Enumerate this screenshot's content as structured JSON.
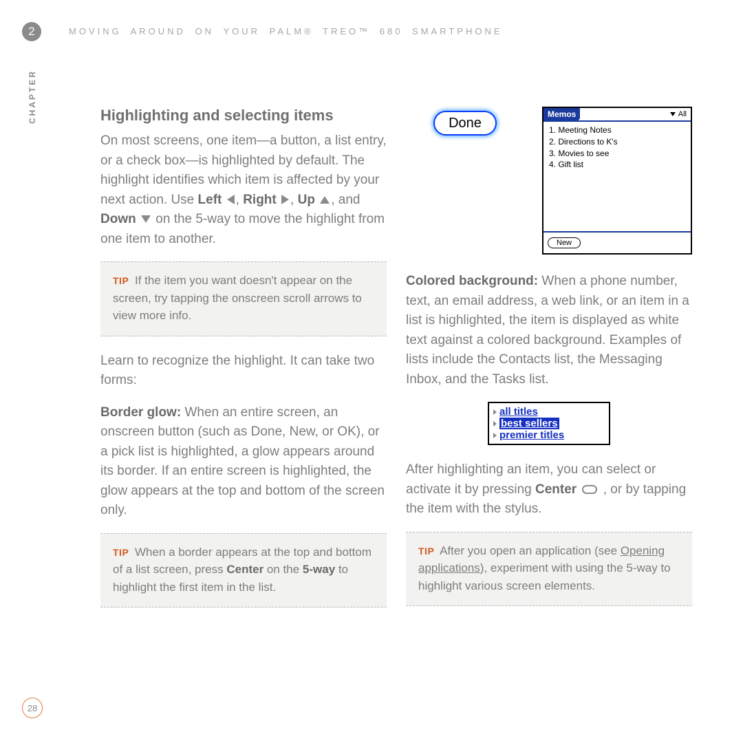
{
  "page": {
    "chapter_number": "2",
    "chapter_label": "CHAPTER",
    "running_header": "MOVING AROUND ON YOUR PALM® TREO™ 680 SMARTPHONE",
    "page_number": "28"
  },
  "heading": "Highlighting and selecting items",
  "para_intro_1": "On most screens, one item—a button, a list entry, or a check box—is highlighted by default. The highlight identifies which item is affected by your next action. Use ",
  "kw_left": "Left",
  "kw_right": "Right",
  "kw_up": "Up",
  "kw_down": "Down",
  "para_intro_2": " on the 5-way to move the highlight from one item to another.",
  "tip1": {
    "label": "TIP",
    "text": "If the item you want doesn't appear on the screen, try tapping the onscreen scroll arrows to view more info."
  },
  "para_learn": "Learn to recognize the highlight. It can take two forms:",
  "border_glow": {
    "title": "Border glow:",
    "text": " When an entire screen, an onscreen button (such as Done, New, or OK), or a pick list is highlighted, a glow appears around its border. If an entire screen is highlighted, the glow appears at the top and bottom of the screen only."
  },
  "tip2": {
    "label": "TIP",
    "t1": "When a border appears at the top and bottom of a list screen, press ",
    "b1": "Center",
    "t2": " on the ",
    "b2": "5-way",
    "t3": " to highlight the first item in the list."
  },
  "done_button": "Done",
  "memos": {
    "title": "Memos",
    "filter": "All",
    "items": [
      "1. Meeting Notes",
      "2. Directions to K's",
      "3. Movies to see",
      "4. Gift list"
    ],
    "new_btn": "New"
  },
  "colored_bg": {
    "title": "Colored background:",
    "text": " When a phone number, text, an email address, a web link, or an item in a list is highlighted, the item is displayed as white text against a colored background. Examples of lists include the Contacts list, the Messaging Inbox, and the Tasks list."
  },
  "linklist": {
    "items": [
      "all titles",
      "best sellers",
      "premier titles"
    ],
    "selected_index": 1
  },
  "para_after": {
    "t1": "After highlighting an item, you can select or activate it by pressing ",
    "b1": "Center",
    "t2": " , or by tapping the item with the stylus."
  },
  "tip3": {
    "label": "TIP",
    "t1": "After you open an application (see ",
    "link": "Opening applications",
    "t2": "), experiment with using the 5-way to highlight various screen elements."
  }
}
